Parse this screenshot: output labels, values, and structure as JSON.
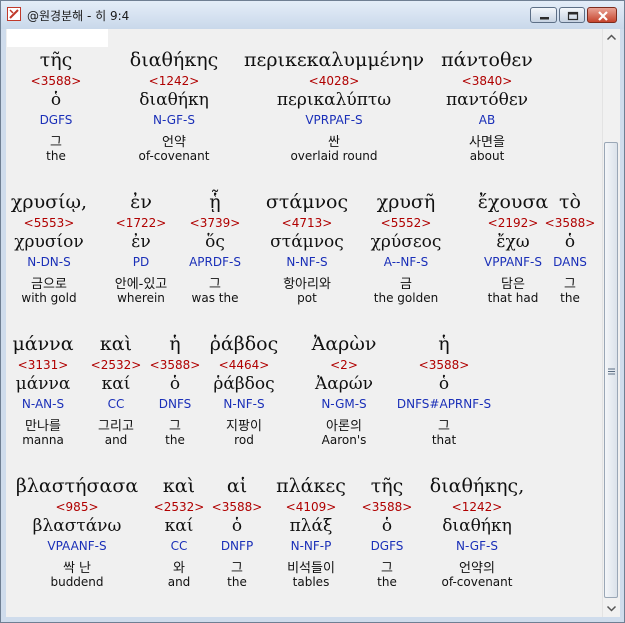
{
  "window": {
    "title": "@원경분해 - 히 9:4"
  },
  "icons": {
    "app": "app-icon",
    "minimize": "minimize-icon",
    "maximize": "maximize-icon",
    "close": "close-icon",
    "scroll_up": "scroll-up-icon",
    "scroll_down": "scroll-down-icon",
    "grip": "scroll-grip-icon"
  },
  "rows": [
    {
      "words": [
        {
          "greek": "τῆς",
          "strong": "<3588>",
          "lemma": "ὁ",
          "morph": "DGFS",
          "korean": "그",
          "english": "the"
        },
        {
          "greek": "διαθήκης",
          "strong": "<1242>",
          "lemma": "διαθήκη",
          "morph": "N-GF-S",
          "korean": "언약",
          "english": "of-covenant"
        },
        {
          "greek": "περικεκαλυμμένην",
          "strong": "<4028>",
          "lemma": "περικαλύπτω",
          "morph": "VPRPAF-S",
          "korean": "싼",
          "english": "overlaid round"
        },
        {
          "greek": "πάντοθεν",
          "strong": "<3840>",
          "lemma": "παντόθεν",
          "morph": "AB",
          "korean": "사면을",
          "english": "about"
        }
      ]
    },
    {
      "words": [
        {
          "greek": "χρυσίῳ,",
          "strong": "<5553>",
          "lemma": "χρυσίον",
          "morph": "N-DN-S",
          "korean": "금으로",
          "english": "with gold"
        },
        {
          "greek": "ἐν",
          "strong": "<1722>",
          "lemma": "ἐν",
          "morph": "PD",
          "korean": "안에-있고",
          "english": "wherein"
        },
        {
          "greek": "ᾗ",
          "strong": "<3739>",
          "lemma": "ὅς",
          "morph": "APRDF-S",
          "korean": "그",
          "english": "was the"
        },
        {
          "greek": "στάμνος",
          "strong": "<4713>",
          "lemma": "στάμνος",
          "morph": "N-NF-S",
          "korean": "항아리와",
          "english": "pot"
        },
        {
          "greek": "χρυσῆ",
          "strong": "<5552>",
          "lemma": "χρύσεος",
          "morph": "A--NF-S",
          "korean": "금",
          "english": "the golden"
        },
        {
          "greek": "ἔχουσα",
          "strong": "<2192>",
          "lemma": "ἔχω",
          "morph": "VPPANF-S",
          "korean": "담은",
          "english": "that had"
        },
        {
          "greek": "τὸ",
          "strong": "<3588>",
          "lemma": "ὁ",
          "morph": "DANS",
          "korean": "그",
          "english": "the"
        }
      ]
    },
    {
      "words": [
        {
          "greek": "μάννα",
          "strong": "<3131>",
          "lemma": "μάννα",
          "morph": "N-AN-S",
          "korean": "만나를",
          "english": "manna"
        },
        {
          "greek": "καὶ",
          "strong": "<2532>",
          "lemma": "καί",
          "morph": "CC",
          "korean": "그리고",
          "english": "and"
        },
        {
          "greek": "ἡ",
          "strong": "<3588>",
          "lemma": "ὁ",
          "morph": "DNFS",
          "korean": "그",
          "english": "the"
        },
        {
          "greek": "ῥάβδος",
          "strong": "<4464>",
          "lemma": "ῥάβδος",
          "morph": "N-NF-S",
          "korean": "지팡이",
          "english": "rod"
        },
        {
          "greek": "Ἀαρὼν",
          "strong": "<2>",
          "lemma": "Ἀαρών",
          "morph": "N-GM-S",
          "korean": "아론의",
          "english": "Aaron's"
        },
        {
          "greek": "ἡ",
          "strong": "<3588>",
          "lemma": "ὁ",
          "morph": "DNFS#APRNF-S",
          "korean": "그",
          "english": "that"
        }
      ]
    },
    {
      "words": [
        {
          "greek": "βλαστήσασα",
          "strong": "<985>",
          "lemma": "βλαστάνω",
          "morph": "VPAANF-S",
          "korean": "싹 난",
          "english": "buddend"
        },
        {
          "greek": "καὶ",
          "strong": "<2532>",
          "lemma": "καί",
          "morph": "CC",
          "korean": "와",
          "english": "and"
        },
        {
          "greek": "αἱ",
          "strong": "<3588>",
          "lemma": "ὁ",
          "morph": "DNFP",
          "korean": "그",
          "english": "the"
        },
        {
          "greek": "πλάκες",
          "strong": "<4109>",
          "lemma": "πλάξ",
          "morph": "N-NF-P",
          "korean": "비석들이",
          "english": "tables"
        },
        {
          "greek": "τῆς",
          "strong": "<3588>",
          "lemma": "ὁ",
          "morph": "DGFS",
          "korean": "그",
          "english": "the"
        },
        {
          "greek": "διαθήκης,",
          "strong": "<1242>",
          "lemma": "διαθήκη",
          "morph": "N-GF-S",
          "korean": "언약의",
          "english": "of-covenant"
        }
      ]
    }
  ]
}
